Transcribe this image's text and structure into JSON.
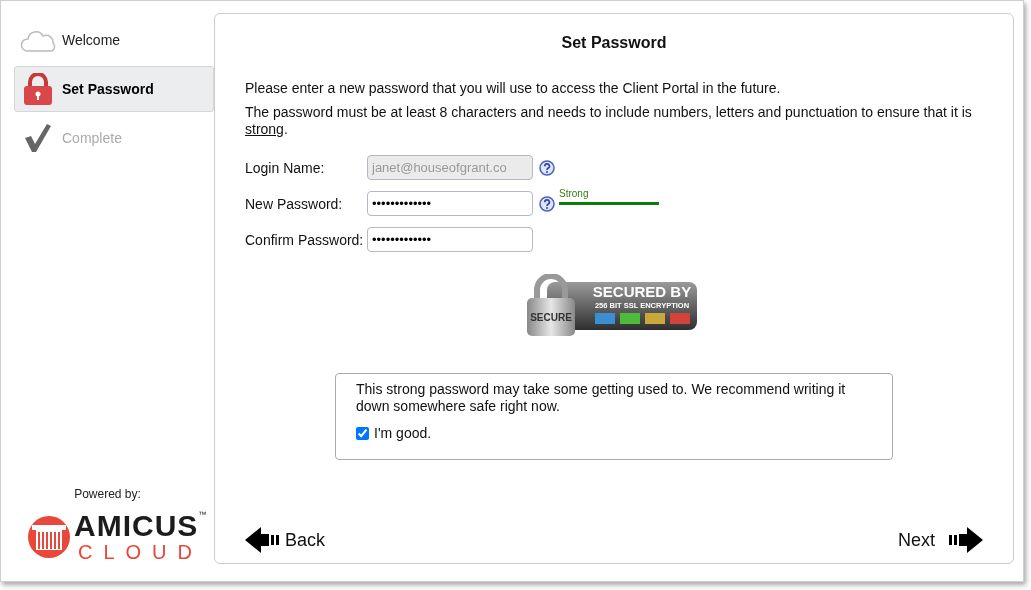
{
  "steps": [
    {
      "label": "Welcome",
      "kind": "cloud",
      "selected": false,
      "disabled": false
    },
    {
      "label": "Set Password",
      "kind": "lock",
      "selected": true,
      "disabled": false
    },
    {
      "label": "Complete",
      "kind": "check",
      "selected": false,
      "disabled": true
    }
  ],
  "powered_by": "Powered by:",
  "logo": {
    "name": "AMICUS",
    "trademark": "™",
    "tagline": "CLOUD"
  },
  "title": "Set Password",
  "intro": "Please enter a new password that you will use to access the Client Portal in the future.",
  "rule": {
    "text": "The password must be at least 8 characters and needs to include numbers, letters and punctuation to ensure that it is ",
    "link": "strong",
    "end": "."
  },
  "fields": [
    {
      "label": "Login Name:",
      "value": "janet@houseofgrant.co",
      "disabled": true,
      "help": true
    },
    {
      "label": "New Password:",
      "value": "•••••••••••••",
      "disabled": false,
      "help": true,
      "strength": {
        "label": "Strong",
        "level": 1
      }
    },
    {
      "label": "Confirm Password:",
      "value": "•••••••••••••",
      "disabled": false,
      "help": false
    }
  ],
  "badge": {
    "lock_text": "SECURE",
    "heading": "SECURED BY",
    "subheading": "256 BIT SSL ENCRYPTION"
  },
  "notice": {
    "text": "This strong password may take some getting used to. We recommend writing it down somewhere safe right now.",
    "checkbox": {
      "label": "I'm good.",
      "checked": true
    }
  },
  "nav": {
    "back": "Back",
    "next": "Next"
  }
}
